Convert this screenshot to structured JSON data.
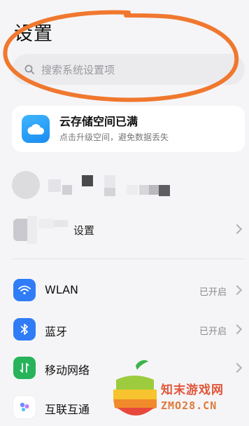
{
  "header": {
    "title": "设置"
  },
  "search": {
    "placeholder": "搜索系统设置项"
  },
  "cloud_banner": {
    "title": "云存储空间已满",
    "subtitle": "点击升级空间，避免数据丢失",
    "icon": "cloud-icon"
  },
  "device": {
    "label_fragment": "设置"
  },
  "settings": [
    {
      "label": "WLAN",
      "status": "已开启",
      "icon": "wifi-icon",
      "color": "#2f7cf6"
    },
    {
      "label": "蓝牙",
      "status": "已开启",
      "icon": "bluetooth-icon",
      "color": "#2f7cf6"
    },
    {
      "label": "移动网络",
      "status": "",
      "icon": "mobile-data-icon",
      "color": "#27b35a"
    },
    {
      "label": "互联互通",
      "status": "",
      "icon": "interconnect-icon",
      "color": "#ffffff"
    }
  ],
  "watermark": {
    "title": "知末游戏网",
    "domain": "ZMO28.CN"
  },
  "colors": {
    "annotation": "#f0782e",
    "accent": "#2f7cf6"
  }
}
